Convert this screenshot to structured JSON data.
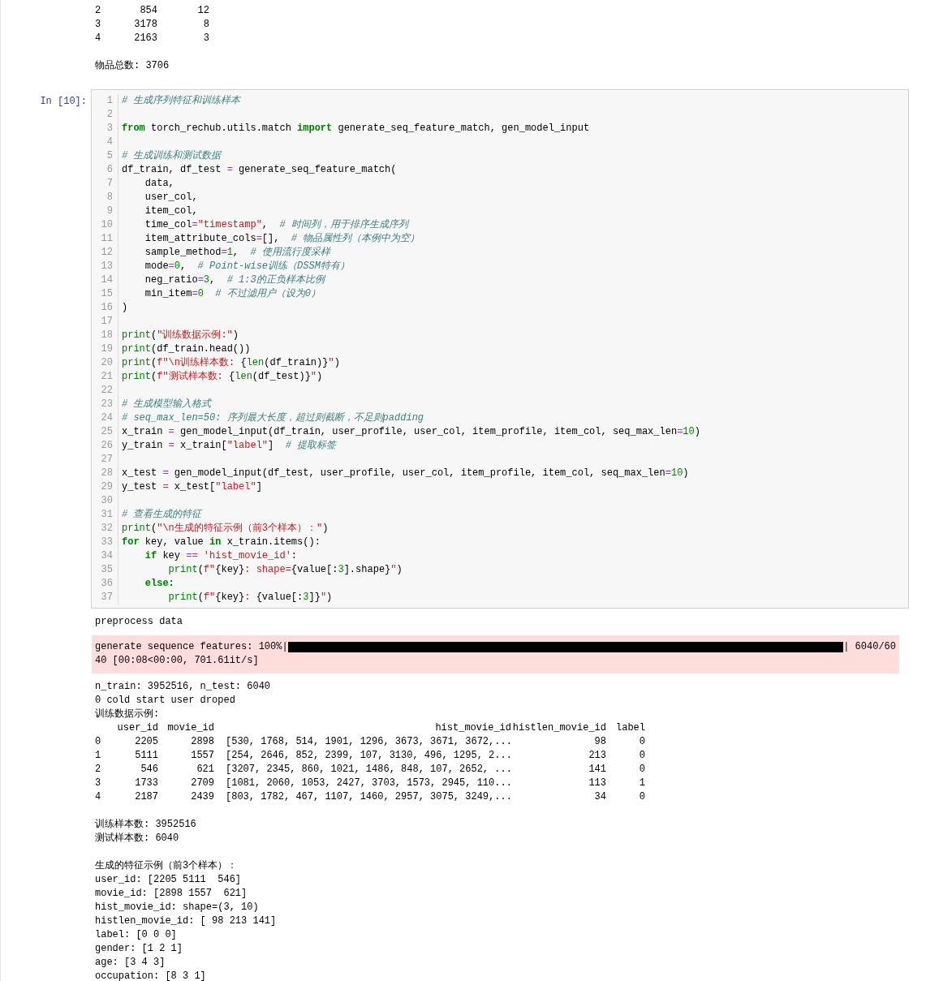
{
  "previous_output": [
    {
      "kind": "table",
      "rows": [
        [
          "2",
          "854",
          "12"
        ],
        [
          "3",
          "3178",
          "8"
        ],
        [
          "4",
          "2163",
          "3"
        ]
      ]
    },
    {
      "kind": "stream",
      "paragraphs": [
        [
          "物品总数: 3706"
        ]
      ]
    }
  ],
  "cell": {
    "prompt": "In [10]:",
    "lines": [
      {
        "n": "1",
        "tokens": [
          {
            "kind": "c",
            "text": "# 生成序列特征和训练样本"
          }
        ]
      },
      {
        "n": "2"
      },
      {
        "n": "3",
        "tokens": [
          {
            "kind": "k",
            "text": "from"
          },
          {
            "kind": "p",
            "text": " torch_rechub.utils.match "
          },
          {
            "kind": "k",
            "text": "import"
          },
          {
            "kind": "p",
            "text": " generate_seq_feature_match, gen_model_input"
          }
        ]
      },
      {
        "n": "4"
      },
      {
        "n": "5",
        "tokens": [
          {
            "kind": "c",
            "text": "# 生成训练和测试数据"
          }
        ]
      },
      {
        "n": "6",
        "tokens": [
          {
            "kind": "p",
            "text": "df_train, df_test "
          },
          {
            "kind": "o",
            "text": "="
          },
          {
            "kind": "p",
            "text": " generate_seq_feature_match("
          }
        ]
      },
      {
        "n": "7",
        "tokens": [
          {
            "kind": "p",
            "text": "    data,"
          }
        ]
      },
      {
        "n": "8",
        "tokens": [
          {
            "kind": "p",
            "text": "    user_col,"
          }
        ]
      },
      {
        "n": "9",
        "tokens": [
          {
            "kind": "p",
            "text": "    item_col,"
          }
        ]
      },
      {
        "n": "10",
        "tokens": [
          {
            "kind": "p",
            "text": "    time_col"
          },
          {
            "kind": "o",
            "text": "="
          },
          {
            "kind": "s",
            "text": "\"timestamp\""
          },
          {
            "kind": "p",
            "text": ","
          },
          {
            "kind": "c",
            "text": "  # 时间列，用于排序生成序列"
          }
        ]
      },
      {
        "n": "11",
        "tokens": [
          {
            "kind": "p",
            "text": "    item_attribute_cols"
          },
          {
            "kind": "o",
            "text": "="
          },
          {
            "kind": "p",
            "text": "[],"
          },
          {
            "kind": "c",
            "text": "  # 物品属性列（本例中为空）"
          }
        ]
      },
      {
        "n": "12",
        "tokens": [
          {
            "kind": "p",
            "text": "    sample_method"
          },
          {
            "kind": "o",
            "text": "="
          },
          {
            "kind": "n",
            "text": "1"
          },
          {
            "kind": "p",
            "text": ","
          },
          {
            "kind": "c",
            "text": "  # 使用流行度采样"
          }
        ]
      },
      {
        "n": "13",
        "tokens": [
          {
            "kind": "p",
            "text": "    mode"
          },
          {
            "kind": "o",
            "text": "="
          },
          {
            "kind": "n",
            "text": "0"
          },
          {
            "kind": "p",
            "text": ","
          },
          {
            "kind": "c",
            "text": "  # Point-wise训练（DSSM特有）"
          }
        ]
      },
      {
        "n": "14",
        "tokens": [
          {
            "kind": "p",
            "text": "    neg_ratio"
          },
          {
            "kind": "o",
            "text": "="
          },
          {
            "kind": "n",
            "text": "3"
          },
          {
            "kind": "p",
            "text": ","
          },
          {
            "kind": "c",
            "text": "  # 1:3的正负样本比例"
          }
        ]
      },
      {
        "n": "15",
        "tokens": [
          {
            "kind": "p",
            "text": "    min_item"
          },
          {
            "kind": "o",
            "text": "="
          },
          {
            "kind": "n",
            "text": "0"
          },
          {
            "kind": "c",
            "text": "  # 不过滤用户（设为0）"
          }
        ]
      },
      {
        "n": "16",
        "tokens": [
          {
            "kind": "p",
            "text": ")"
          }
        ]
      },
      {
        "n": "17"
      },
      {
        "n": "18",
        "tokens": [
          {
            "kind": "b",
            "text": "print"
          },
          {
            "kind": "p",
            "text": "("
          },
          {
            "kind": "s",
            "text": "\"训练数据示例:\""
          },
          {
            "kind": "p",
            "text": ")"
          }
        ]
      },
      {
        "n": "19",
        "tokens": [
          {
            "kind": "b",
            "text": "print"
          },
          {
            "kind": "p",
            "text": "(df_train.head())"
          }
        ]
      },
      {
        "n": "20",
        "tokens": [
          {
            "kind": "b",
            "text": "print"
          },
          {
            "kind": "p",
            "text": "("
          },
          {
            "kind": "s",
            "text": "f\"\\n训练样本数: "
          },
          {
            "kind": "p",
            "text": "{"
          },
          {
            "kind": "b",
            "text": "len"
          },
          {
            "kind": "p",
            "text": "(df_train)}"
          },
          {
            "kind": "s",
            "text": "\""
          },
          {
            "kind": "p",
            "text": ")"
          }
        ]
      },
      {
        "n": "21",
        "tokens": [
          {
            "kind": "b",
            "text": "print"
          },
          {
            "kind": "p",
            "text": "("
          },
          {
            "kind": "s",
            "text": "f\"测试样本数: "
          },
          {
            "kind": "p",
            "text": "{"
          },
          {
            "kind": "b",
            "text": "len"
          },
          {
            "kind": "p",
            "text": "(df_test)}"
          },
          {
            "kind": "s",
            "text": "\""
          },
          {
            "kind": "p",
            "text": ")"
          }
        ]
      },
      {
        "n": "22"
      },
      {
        "n": "23",
        "tokens": [
          {
            "kind": "c",
            "text": "# 生成模型输入格式"
          }
        ]
      },
      {
        "n": "24",
        "tokens": [
          {
            "kind": "c",
            "text": "# seq_max_len=50: 序列最大长度，超过则截断，不足则padding"
          }
        ]
      },
      {
        "n": "25",
        "tokens": [
          {
            "kind": "p",
            "text": "x_train "
          },
          {
            "kind": "o",
            "text": "="
          },
          {
            "kind": "p",
            "text": " gen_model_input(df_train, user_profile, user_col, item_profile, item_col, seq_max_len"
          },
          {
            "kind": "o",
            "text": "="
          },
          {
            "kind": "n",
            "text": "10"
          },
          {
            "kind": "p",
            "text": ")"
          }
        ]
      },
      {
        "n": "26",
        "tokens": [
          {
            "kind": "p",
            "text": "y_train "
          },
          {
            "kind": "o",
            "text": "="
          },
          {
            "kind": "p",
            "text": " x_train["
          },
          {
            "kind": "s",
            "text": "\"label\""
          },
          {
            "kind": "p",
            "text": "]"
          },
          {
            "kind": "c",
            "text": "  # 提取标签"
          }
        ]
      },
      {
        "n": "27"
      },
      {
        "n": "28",
        "tokens": [
          {
            "kind": "p",
            "text": "x_test "
          },
          {
            "kind": "o",
            "text": "="
          },
          {
            "kind": "p",
            "text": " gen_model_input(df_test, user_profile, user_col, item_profile, item_col, seq_max_len"
          },
          {
            "kind": "o",
            "text": "="
          },
          {
            "kind": "n",
            "text": "10"
          },
          {
            "kind": "p",
            "text": ")"
          }
        ]
      },
      {
        "n": "29",
        "tokens": [
          {
            "kind": "p",
            "text": "y_test "
          },
          {
            "kind": "o",
            "text": "="
          },
          {
            "kind": "p",
            "text": " x_test["
          },
          {
            "kind": "s",
            "text": "\"label\""
          },
          {
            "kind": "p",
            "text": "]"
          }
        ]
      },
      {
        "n": "30"
      },
      {
        "n": "31",
        "tokens": [
          {
            "kind": "c",
            "text": "# 查看生成的特征"
          }
        ]
      },
      {
        "n": "32",
        "tokens": [
          {
            "kind": "b",
            "text": "print"
          },
          {
            "kind": "p",
            "text": "("
          },
          {
            "kind": "s",
            "text": "\"\\n生成的特征示例（前3个样本）：\""
          },
          {
            "kind": "p",
            "text": ")"
          }
        ]
      },
      {
        "n": "33",
        "tokens": [
          {
            "kind": "k",
            "text": "for"
          },
          {
            "kind": "p",
            "text": " key, value "
          },
          {
            "kind": "k",
            "text": "in"
          },
          {
            "kind": "p",
            "text": " x_train.items():"
          }
        ]
      },
      {
        "n": "34",
        "tokens": [
          {
            "kind": "k",
            "text": "    if"
          },
          {
            "kind": "p",
            "text": " key "
          },
          {
            "kind": "o",
            "text": "=="
          },
          {
            "kind": "s",
            "text": " 'hist_movie_id'"
          },
          {
            "kind": "p",
            "text": ":"
          }
        ]
      },
      {
        "n": "35",
        "tokens": [
          {
            "kind": "b",
            "text": "        print"
          },
          {
            "kind": "p",
            "text": "("
          },
          {
            "kind": "s",
            "text": "f\""
          },
          {
            "kind": "p",
            "text": "{key}"
          },
          {
            "kind": "s",
            "text": ": shape="
          },
          {
            "kind": "p",
            "text": "{value[:"
          },
          {
            "kind": "n",
            "text": "3"
          },
          {
            "kind": "p",
            "text": "].shape}"
          },
          {
            "kind": "s",
            "text": "\""
          },
          {
            "kind": "p",
            "text": ")"
          }
        ]
      },
      {
        "n": "36",
        "tokens": [
          {
            "kind": "k",
            "text": "    else"
          },
          {
            "kind": "p",
            "text": ":"
          }
        ]
      },
      {
        "n": "37",
        "tokens": [
          {
            "kind": "b",
            "text": "        print"
          },
          {
            "kind": "p",
            "text": "("
          },
          {
            "kind": "s",
            "text": "f\""
          },
          {
            "kind": "p",
            "text": "{key}"
          },
          {
            "kind": "s",
            "text": ": "
          },
          {
            "kind": "p",
            "text": "{value[:"
          },
          {
            "kind": "n",
            "text": "3"
          },
          {
            "kind": "p",
            "text": "]}"
          },
          {
            "kind": "s",
            "text": "\""
          },
          {
            "kind": "p",
            "text": ")"
          }
        ]
      }
    ]
  },
  "outputs": [
    {
      "kind": "stream",
      "paragraphs": [
        [
          "preprocess data"
        ]
      ]
    },
    {
      "kind": "stderr",
      "prefix": "generate sequence features: 100%|",
      "suffix": "| 6040/60",
      "continuation": "40 [00:08<00:00, 701.61it/s]"
    },
    {
      "kind": "stream",
      "paragraphs": [
        [
          "n_train: 3952516, n_test: 6040",
          "0 cold start user droped",
          "训练数据示例:"
        ]
      ]
    },
    {
      "kind": "table",
      "columns": [
        "",
        "user_id",
        "movie_id",
        "hist_movie_id",
        "histlen_movie_id",
        "label"
      ],
      "rows": [
        [
          "0",
          "2205",
          "2898",
          "[530, 1768, 514, 1901, 1296, 3673, 3671, 3672,...",
          "98",
          "0"
        ],
        [
          "1",
          "5111",
          "1557",
          "[254, 2646, 852, 2399, 107, 3130, 496, 1295, 2...",
          "213",
          "0"
        ],
        [
          "2",
          "546",
          "621",
          "[3207, 2345, 860, 1021, 1486, 848, 107, 2652, ...",
          "141",
          "0"
        ],
        [
          "3",
          "1733",
          "2709",
          "[1081, 2060, 1053, 2427, 3703, 1573, 2945, 110...",
          "113",
          "1"
        ],
        [
          "4",
          "2187",
          "2439",
          "[803, 1782, 467, 1107, 1460, 2957, 3075, 3249,...",
          "34",
          "0"
        ]
      ]
    },
    {
      "kind": "stream",
      "paragraphs": [
        [
          "训练样本数: 3952516",
          "测试样本数: 6040"
        ],
        [
          "生成的特征示例（前3个样本）：",
          "user_id: [2205 5111  546]",
          "movie_id: [2898 1557  621]",
          "hist_movie_id: shape=(3, 10)",
          "histlen_movie_id: [ 98 213 141]",
          "label: [0 0 0]",
          "gender: [1 2 1]",
          "age: [3 4 3]",
          "occupation: [8 3 1]"
        ]
      ]
    }
  ]
}
